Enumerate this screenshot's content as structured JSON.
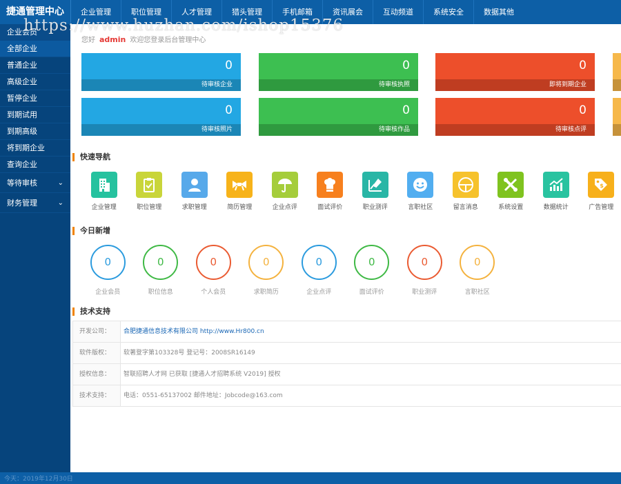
{
  "app": {
    "title": "捷通管理中心"
  },
  "topnav": [
    {
      "label": "企业管理"
    },
    {
      "label": "职位管理"
    },
    {
      "label": "人才管理"
    },
    {
      "label": "猎头管理"
    },
    {
      "label": "手机邮箱"
    },
    {
      "label": "资讯展会"
    },
    {
      "label": "互动频道"
    },
    {
      "label": "系统安全"
    },
    {
      "label": "数据其他"
    }
  ],
  "watermark": "https://www.huzhan.com/ishop15376",
  "sidebar": {
    "header": "企业会员",
    "items": [
      {
        "label": "全部企业"
      },
      {
        "label": "普通企业"
      },
      {
        "label": "高级企业"
      },
      {
        "label": "暂停企业"
      },
      {
        "label": "到期试用"
      },
      {
        "label": "到期高级"
      },
      {
        "label": "将到期企业"
      },
      {
        "label": "查询企业"
      }
    ],
    "groups": [
      {
        "label": "等待审核",
        "icon": "chevron-down-icon"
      },
      {
        "label": "财务管理",
        "icon": "chevron-down-icon"
      }
    ]
  },
  "welcome": {
    "prefix": "您好",
    "user": "admin",
    "suffix": "欢迎您登录后台管理中心"
  },
  "cards": [
    {
      "value": "0",
      "label": "待审核企业",
      "color": "#23a7e3"
    },
    {
      "value": "0",
      "label": "待审核执照",
      "color": "#3dbf51"
    },
    {
      "value": "0",
      "label": "即将到期企业",
      "color": "#ed4f2b"
    },
    {
      "value": "",
      "label": "",
      "color": "#f6b84a"
    },
    {
      "value": "0",
      "label": "待审核照片",
      "color": "#23a7e3"
    },
    {
      "value": "0",
      "label": "待审核作品",
      "color": "#3dbf51"
    },
    {
      "value": "0",
      "label": "待审核点评",
      "color": "#ed4f2b"
    },
    {
      "value": "",
      "label": "",
      "color": "#f6b84a"
    }
  ],
  "quicknav": {
    "title": "快速导航",
    "items": [
      {
        "label": "企业管理",
        "icon": "building-icon",
        "color": "#26c29f"
      },
      {
        "label": "职位管理",
        "icon": "clipboard-icon",
        "color": "#c9d53a"
      },
      {
        "label": "求职管理",
        "icon": "person-icon",
        "color": "#57a9ea"
      },
      {
        "label": "简历管理",
        "icon": "bowtie-icon",
        "color": "#f7b31a"
      },
      {
        "label": "企业点评",
        "icon": "umbrella-icon",
        "color": "#a5cd3b"
      },
      {
        "label": "面试评价",
        "icon": "chef-hat-icon",
        "color": "#f7801e"
      },
      {
        "label": "职业测评",
        "icon": "chart-edit-icon",
        "color": "#29b6a6"
      },
      {
        "label": "言职社区",
        "icon": "smile-icon",
        "color": "#52aef0"
      },
      {
        "label": "留言消息",
        "icon": "circle-line-icon",
        "color": "#f6c22c"
      },
      {
        "label": "系统设置",
        "icon": "tools-icon",
        "color": "#7fc31f"
      },
      {
        "label": "数据统计",
        "icon": "trend-icon",
        "color": "#29c3a0"
      },
      {
        "label": "广告管理",
        "icon": "tag-icon",
        "color": "#f7b01b"
      }
    ]
  },
  "today": {
    "title": "今日新增",
    "items": [
      {
        "label": "企业会员",
        "value": "0",
        "color": "#2b9bde"
      },
      {
        "label": "职位信息",
        "value": "0",
        "color": "#3fb945"
      },
      {
        "label": "个人会员",
        "value": "0",
        "color": "#ea5b32"
      },
      {
        "label": "求职简历",
        "value": "0",
        "color": "#f4b23e"
      },
      {
        "label": "企业点评",
        "value": "0",
        "color": "#2b9bde"
      },
      {
        "label": "面试评价",
        "value": "0",
        "color": "#3fb945"
      },
      {
        "label": "职业测评",
        "value": "0",
        "color": "#ea5b32"
      },
      {
        "label": "言职社区",
        "value": "0",
        "color": "#f4b23e"
      }
    ]
  },
  "support": {
    "title": "技术支持",
    "rows": [
      {
        "key": "开发公司：",
        "value": "合肥捷通信息技术有限公司 http://www.Hr800.cn"
      },
      {
        "key": "软件版权：",
        "value": "软著登字第103328号 登记号：2008SR16149"
      },
      {
        "key": "授权信息：",
        "value": "智联招聘人才网 已获取 [捷通人才招聘系统 V2019] 授权"
      },
      {
        "key": "技术支持：",
        "value": "电话：0551-65137002 邮件地址：Jobcode@163.com"
      }
    ]
  },
  "footer": {
    "date": "今天：2019年12月30日"
  }
}
